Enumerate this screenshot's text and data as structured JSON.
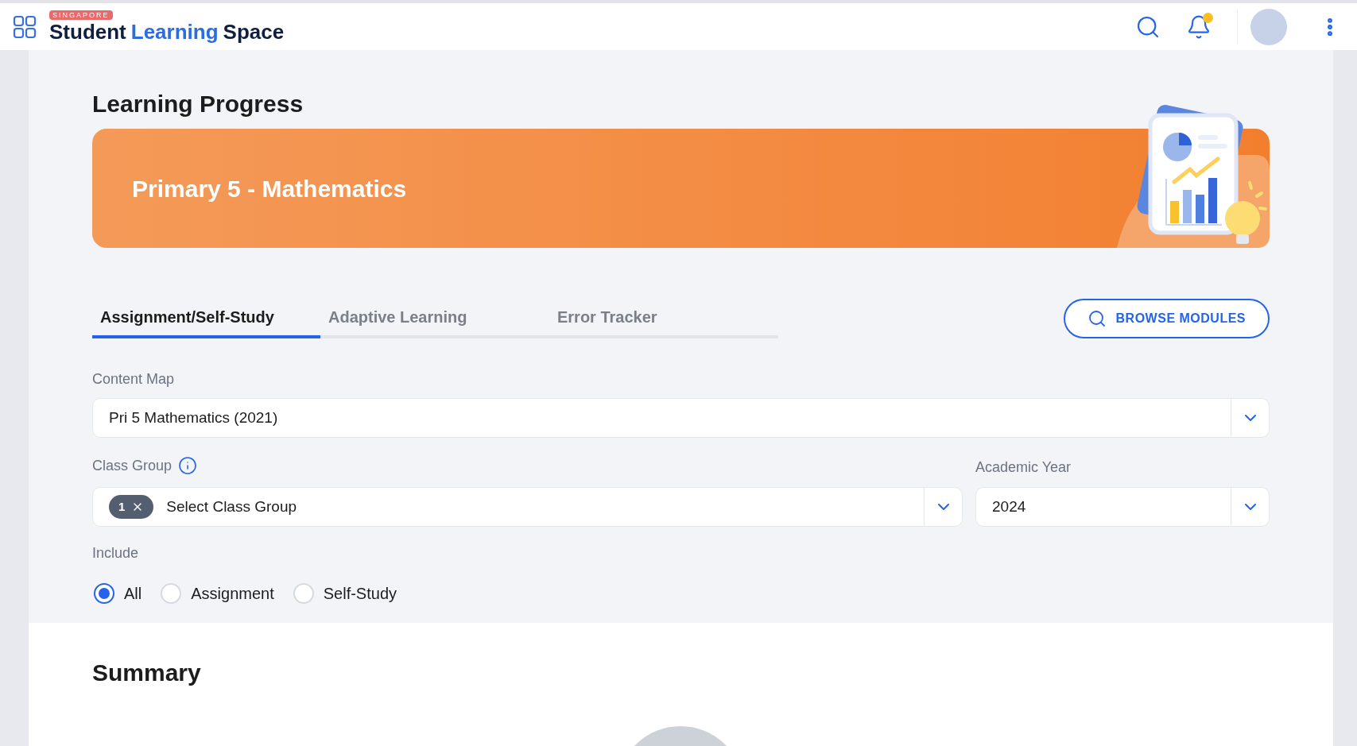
{
  "header": {
    "logo_tag": "SINGAPORE",
    "logo_words": [
      "Student",
      "Learning",
      "Space"
    ],
    "notification_dot": true
  },
  "page": {
    "title": "Learning Progress",
    "banner_title": "Primary 5 - Mathematics"
  },
  "tabs": [
    {
      "label": "Assignment/Self-Study",
      "selected": true
    },
    {
      "label": "Adaptive Learning",
      "selected": false
    },
    {
      "label": "Error Tracker",
      "selected": false
    }
  ],
  "browse_button": "BROWSE MODULES",
  "content_map": {
    "label": "Content Map",
    "value": "Pri 5 Mathematics (2021)"
  },
  "class_group": {
    "label": "Class Group",
    "chip": "1",
    "placeholder": "Select Class Group"
  },
  "academic_year": {
    "label": "Academic Year",
    "value": "2024"
  },
  "include": {
    "label": "Include",
    "options": [
      {
        "label": "All",
        "selected": true
      },
      {
        "label": "Assignment",
        "selected": false
      },
      {
        "label": "Self-Study",
        "selected": false
      }
    ]
  },
  "summary": {
    "title": "Summary"
  }
}
